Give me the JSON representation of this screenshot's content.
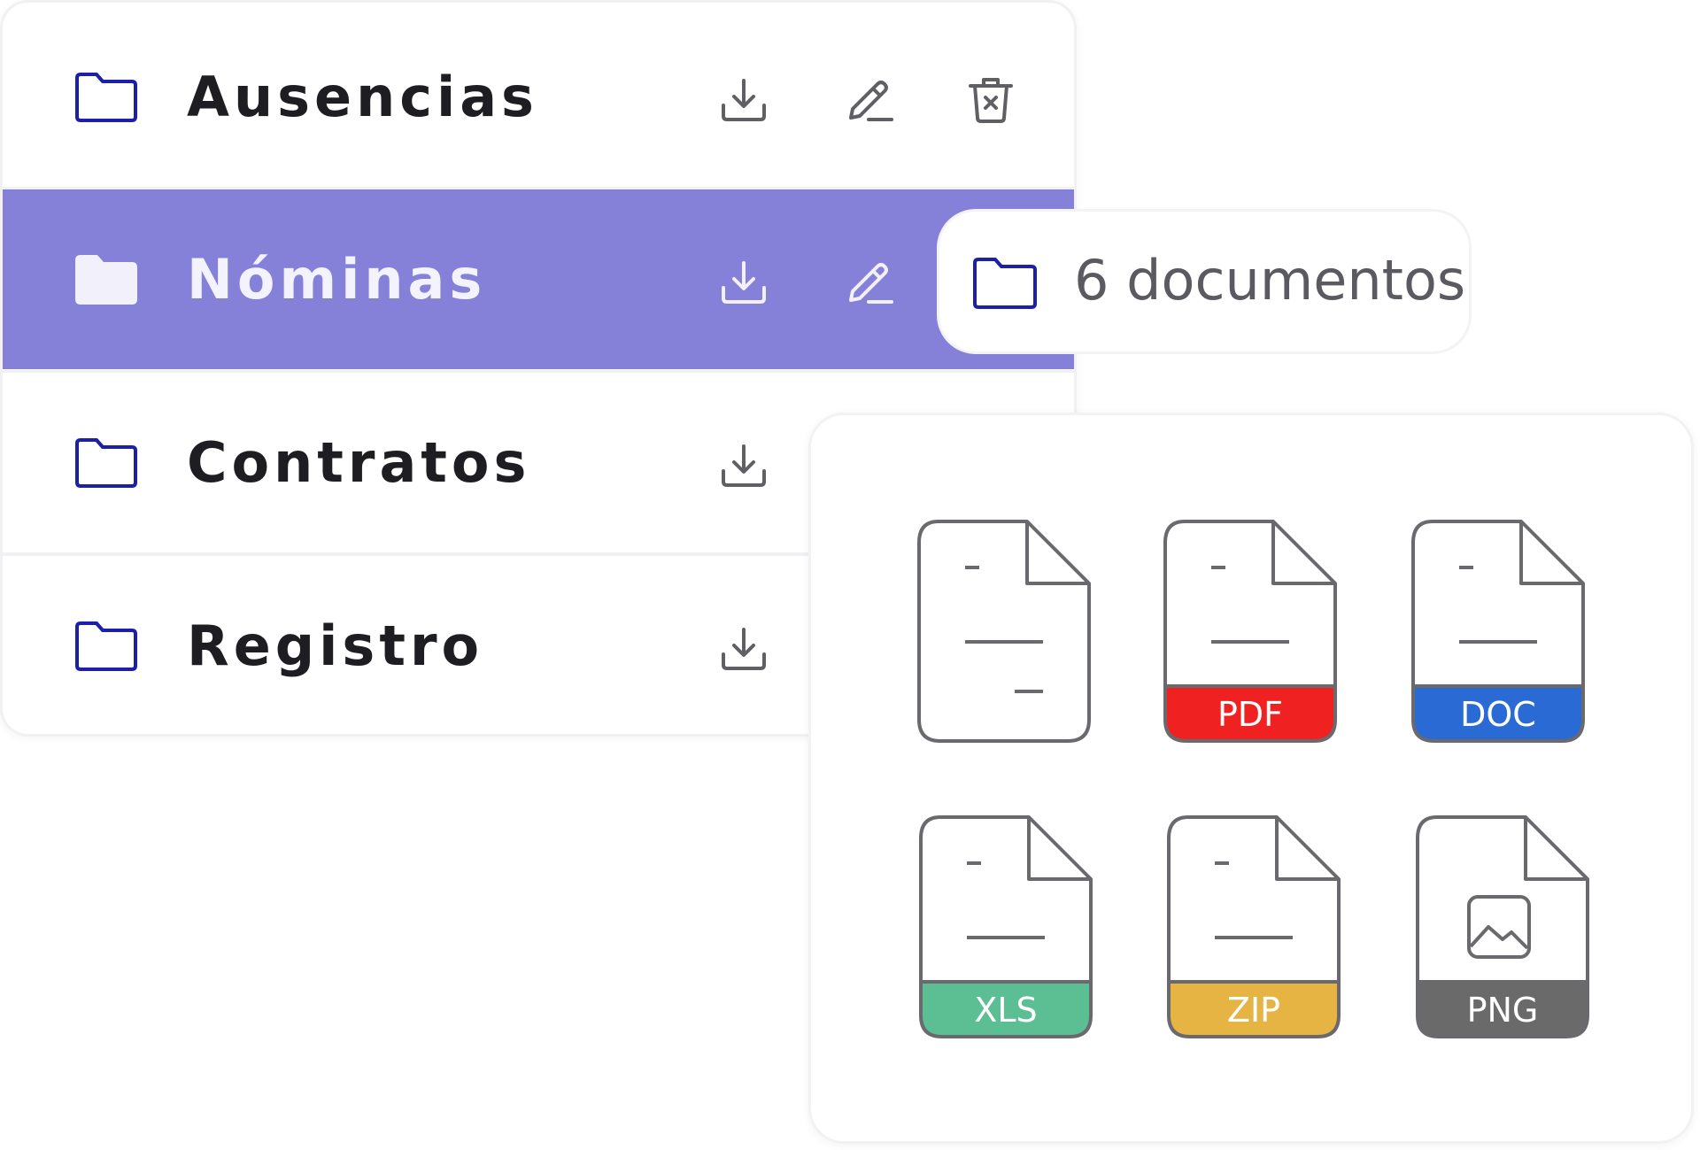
{
  "folders": [
    {
      "name": "Ausencias",
      "actions": [
        "download",
        "edit",
        "delete"
      ]
    },
    {
      "name": "Nóminas",
      "selected": true,
      "actions": [
        "download",
        "edit"
      ]
    },
    {
      "name": "Contratos",
      "actions": [
        "download"
      ]
    },
    {
      "name": "Registro",
      "actions": [
        "download"
      ]
    }
  ],
  "count_badge": {
    "text": "6 documentos"
  },
  "file_types": [
    {
      "label": "",
      "color": "#ffffff",
      "icon": "generic-file-icon"
    },
    {
      "label": "PDF",
      "color": "#ef2121",
      "icon": "pdf-file-icon"
    },
    {
      "label": "DOC",
      "color": "#2a6ad4",
      "icon": "doc-file-icon"
    },
    {
      "label": "XLS",
      "color": "#5cbf93",
      "icon": "xls-file-icon"
    },
    {
      "label": "ZIP",
      "color": "#e6b443",
      "icon": "zip-file-icon"
    },
    {
      "label": "PNG",
      "color": "#6a6a6a",
      "icon": "png-file-icon"
    }
  ],
  "colors": {
    "accent": "#8580d8",
    "folder_outline": "#1c1fa8",
    "icon_gray": "#5f5f64"
  }
}
